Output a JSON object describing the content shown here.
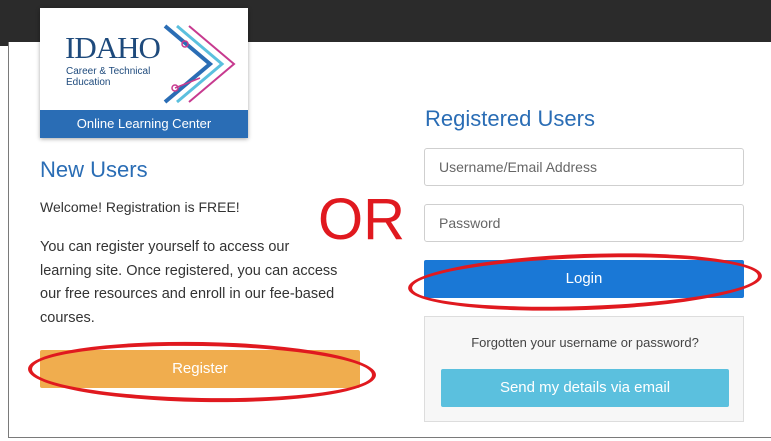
{
  "logo": {
    "wordmark": "IDAHO",
    "subtitle": "Career & Technical Education",
    "band_label": "Online Learning Center"
  },
  "new_users": {
    "title": "New Users",
    "welcome": "Welcome! Registration is FREE!",
    "description": "You can register yourself to access our learning site. Once registered, you can access our free resources and enroll in our fee-based courses.",
    "register_label": "Register"
  },
  "annotation": {
    "or_text": "OR"
  },
  "registered_users": {
    "title": "Registered Users",
    "username_placeholder": "Username/Email Address",
    "password_placeholder": "Password",
    "login_label": "Login",
    "forgot_text": "Forgotten your username or password?",
    "email_button_label": "Send my details via email"
  },
  "colors": {
    "brand_blue": "#2a6db5",
    "login_blue": "#1a78d6",
    "register_orange": "#f0ad4e",
    "email_cyan": "#5bc0de",
    "annotation_red": "#e0191f",
    "topbar_dark": "#2b2b2b"
  }
}
